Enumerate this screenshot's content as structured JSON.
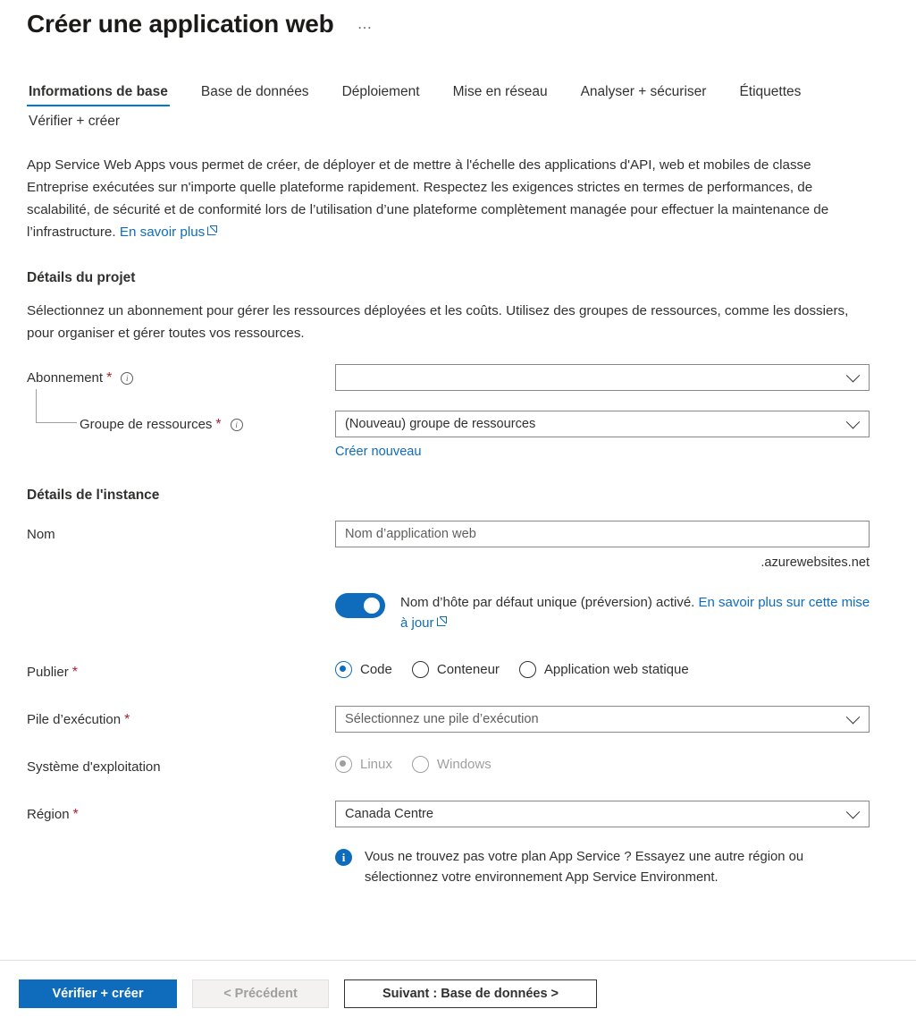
{
  "header": {
    "title": "Créer une application web",
    "more_menu": "…"
  },
  "tabs": [
    {
      "label": "Informations de base",
      "active": true
    },
    {
      "label": "Base de données",
      "active": false
    },
    {
      "label": "Déploiement",
      "active": false
    },
    {
      "label": "Mise en réseau",
      "active": false
    },
    {
      "label": "Analyser + sécuriser",
      "active": false
    },
    {
      "label": "Étiquettes",
      "active": false
    },
    {
      "label": "Vérifier + créer",
      "active": false
    }
  ],
  "intro": {
    "text": "App Service Web Apps vous permet de créer, de déployer et de mettre à l'échelle des applications d'API, web et mobiles de classe Entreprise exécutées sur n'importe quelle plateforme rapidement. Respectez les exigences strictes en termes de performances, de scalabilité, de sécurité et de conformité lors de l’utilisation d’une plateforme complètement managée pour effectuer la maintenance de l’infrastructure.",
    "link": "En savoir plus"
  },
  "project_details": {
    "title": "Détails du projet",
    "description": "Sélectionnez un abonnement pour gérer les ressources déployées et les coûts. Utilisez des groupes de ressources, comme les dossiers, pour organiser et gérer toutes vos ressources.",
    "subscription": {
      "label": "Abonnement",
      "required": "*",
      "value": "",
      "info_icon": "info-icon"
    },
    "resource_group": {
      "label": "Groupe de ressources",
      "required": "*",
      "value": "(Nouveau) groupe de ressources",
      "create_new_link": "Créer nouveau",
      "info_icon": "info-icon"
    }
  },
  "instance_details": {
    "title": "Détails de l'instance",
    "name": {
      "label": "Nom",
      "value": "",
      "placeholder": "Nom d’application web",
      "suffix": ".azurewebsites.net"
    },
    "hostname_toggle": {
      "state": "on",
      "text_before_link": "Nom d’hôte par défaut unique (préversion) activé. ",
      "link": "En savoir plus sur cette mise à jour"
    },
    "publish": {
      "label": "Publier",
      "required": "*",
      "options": [
        {
          "label": "Code",
          "checked": true
        },
        {
          "label": "Conteneur",
          "checked": false
        },
        {
          "label": "Application web statique",
          "checked": false
        }
      ]
    },
    "runtime_stack": {
      "label": "Pile d’exécution",
      "required": "*",
      "value": "Sélectionnez une pile d’exécution"
    },
    "operating_system": {
      "label": "Système d'exploitation",
      "disabled": true,
      "options": [
        {
          "label": "Linux",
          "checked": true
        },
        {
          "label": "Windows",
          "checked": false
        }
      ]
    },
    "region": {
      "label": "Région",
      "required": "*",
      "value": "Canada Centre"
    },
    "region_info": {
      "icon": "info-filled-icon",
      "text": "Vous ne trouvez pas votre plan App Service ? Essayez une autre région ou sélectionnez votre environnement App Service Environment."
    }
  },
  "footer": {
    "review_create": "Vérifier + créer",
    "previous": "< Précédent",
    "next": "Suivant : Base de données >"
  },
  "colors": {
    "accent": "#0f6cbd",
    "required": "#a4262c",
    "text": "#323130",
    "disabled": "#a19f9d",
    "border": "#8a8886"
  }
}
